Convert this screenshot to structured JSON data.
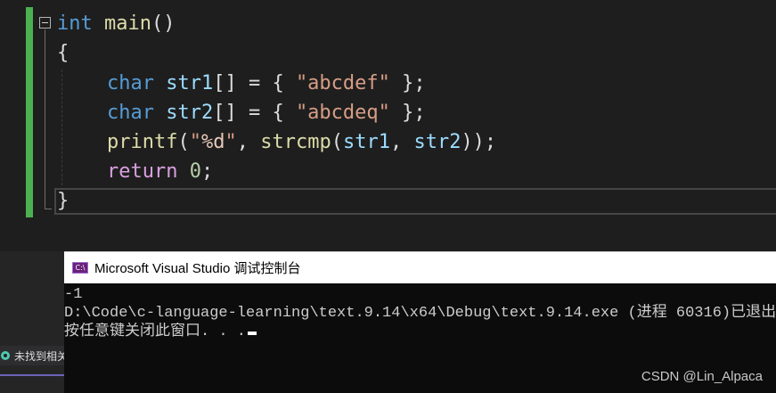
{
  "editor": {
    "lines": [
      [
        [
          "kw",
          "int"
        ],
        [
          "pun",
          " "
        ],
        [
          "fn",
          "main"
        ],
        [
          "pun",
          "()"
        ]
      ],
      [
        [
          "pun",
          "{"
        ]
      ],
      [
        [
          "kw",
          "char"
        ],
        [
          "pun",
          " "
        ],
        [
          "var",
          "str1"
        ],
        [
          "pun",
          "[] = { "
        ],
        [
          "str",
          "\"abcdef\""
        ],
        [
          "pun",
          " };"
        ]
      ],
      [
        [
          "kw",
          "char"
        ],
        [
          "pun",
          " "
        ],
        [
          "var",
          "str2"
        ],
        [
          "pun",
          "[] = { "
        ],
        [
          "str",
          "\"abcdeq\""
        ],
        [
          "pun",
          " };"
        ]
      ],
      [
        [
          "fn",
          "printf"
        ],
        [
          "pun",
          "("
        ],
        [
          "str",
          "\""
        ],
        [
          "esc",
          "%d"
        ],
        [
          "str",
          "\""
        ],
        [
          "pun",
          ", "
        ],
        [
          "fn",
          "strcmp"
        ],
        [
          "pun",
          "("
        ],
        [
          "var",
          "str1"
        ],
        [
          "pun",
          ", "
        ],
        [
          "var",
          "str2"
        ],
        [
          "pun",
          "));"
        ]
      ],
      [
        [
          "ctl",
          "return"
        ],
        [
          "pun",
          " "
        ],
        [
          "num",
          "0"
        ],
        [
          "pun",
          ";"
        ]
      ],
      [
        [
          "pun",
          "}"
        ]
      ]
    ]
  },
  "status": {
    "text": "未找到相关问题",
    "icon": "status-ok-icon"
  },
  "console": {
    "icon_label": "C:\\",
    "title": "Microsoft Visual Studio 调试控制台",
    "output": [
      "-1",
      "D:\\Code\\c-language-learning\\text.9.14\\x64\\Debug\\text.9.14.exe (进程 60316)已退出",
      "按任意键关闭此窗口. . ."
    ]
  },
  "watermark": "CSDN @Lin_Alpaca",
  "colors": {
    "keyword": "#569cd6",
    "function": "#dcdcaa",
    "variable": "#9cdcfe",
    "string": "#d69d85",
    "number": "#b5cea8",
    "control": "#d8a0df",
    "change_bar": "#4caf50"
  }
}
